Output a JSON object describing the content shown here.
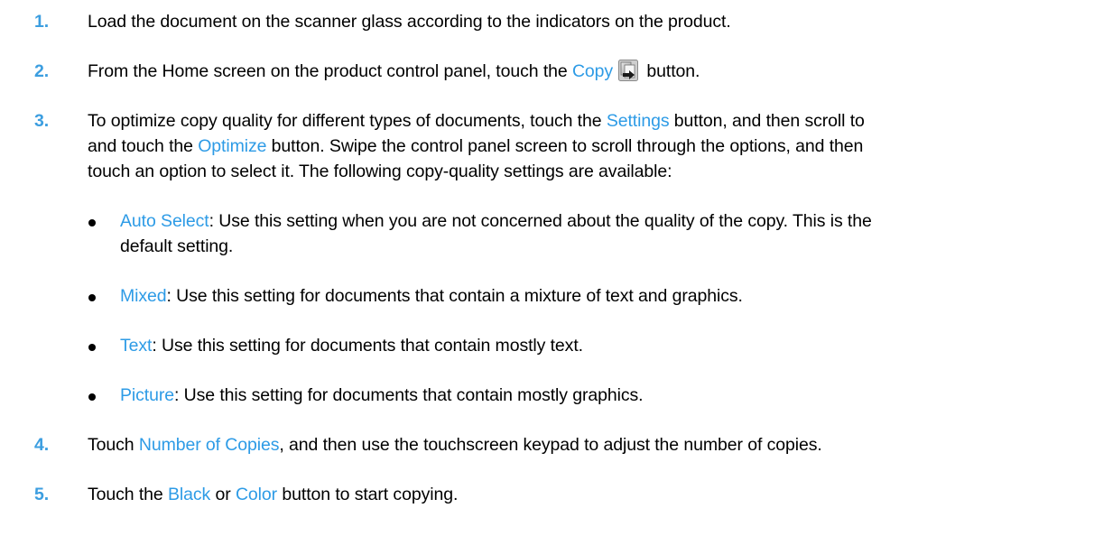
{
  "steps": [
    {
      "number": "1.",
      "text": "Load the document on the scanner glass according to the indicators on the product."
    },
    {
      "number": "2.",
      "before": "From the Home screen on the product control panel, touch the ",
      "ui": "Copy",
      "after": " button."
    },
    {
      "number": "3.",
      "p1": "To optimize copy quality for different types of documents, touch the ",
      "ui1": "Settings",
      "p2": " button, and then scroll to",
      "p3": "and touch the ",
      "ui2": "Optimize",
      "p4": " button. Swipe the control panel screen to scroll through the options, and then",
      "p5": "touch an option to select it. The following copy-quality settings are available:"
    },
    {
      "number": "4.",
      "p1": "Touch ",
      "ui1": "Number of Copies",
      "p2": ", and then use the touchscreen keypad to adjust the number of copies."
    },
    {
      "number": "5.",
      "p1": "Touch the ",
      "ui1": "Black",
      "p2": " or ",
      "ui2": "Color",
      "p3": " button to start copying."
    }
  ],
  "options": [
    {
      "name": "Auto Select",
      "desc": ": Use this setting when you are not concerned about the quality of the copy. This is the",
      "desc2": "default setting."
    },
    {
      "name": "Mixed",
      "desc": ": Use this setting for documents that contain a mixture of text and graphics."
    },
    {
      "name": "Text",
      "desc": ": Use this setting for documents that contain mostly text."
    },
    {
      "name": "Picture",
      "desc": ": Use this setting for documents that contain mostly graphics."
    }
  ],
  "colors": {
    "step_number": "#3c9ee0",
    "ui_term": "#2d9be6"
  },
  "icons": {
    "copy": "copy-button-icon"
  }
}
